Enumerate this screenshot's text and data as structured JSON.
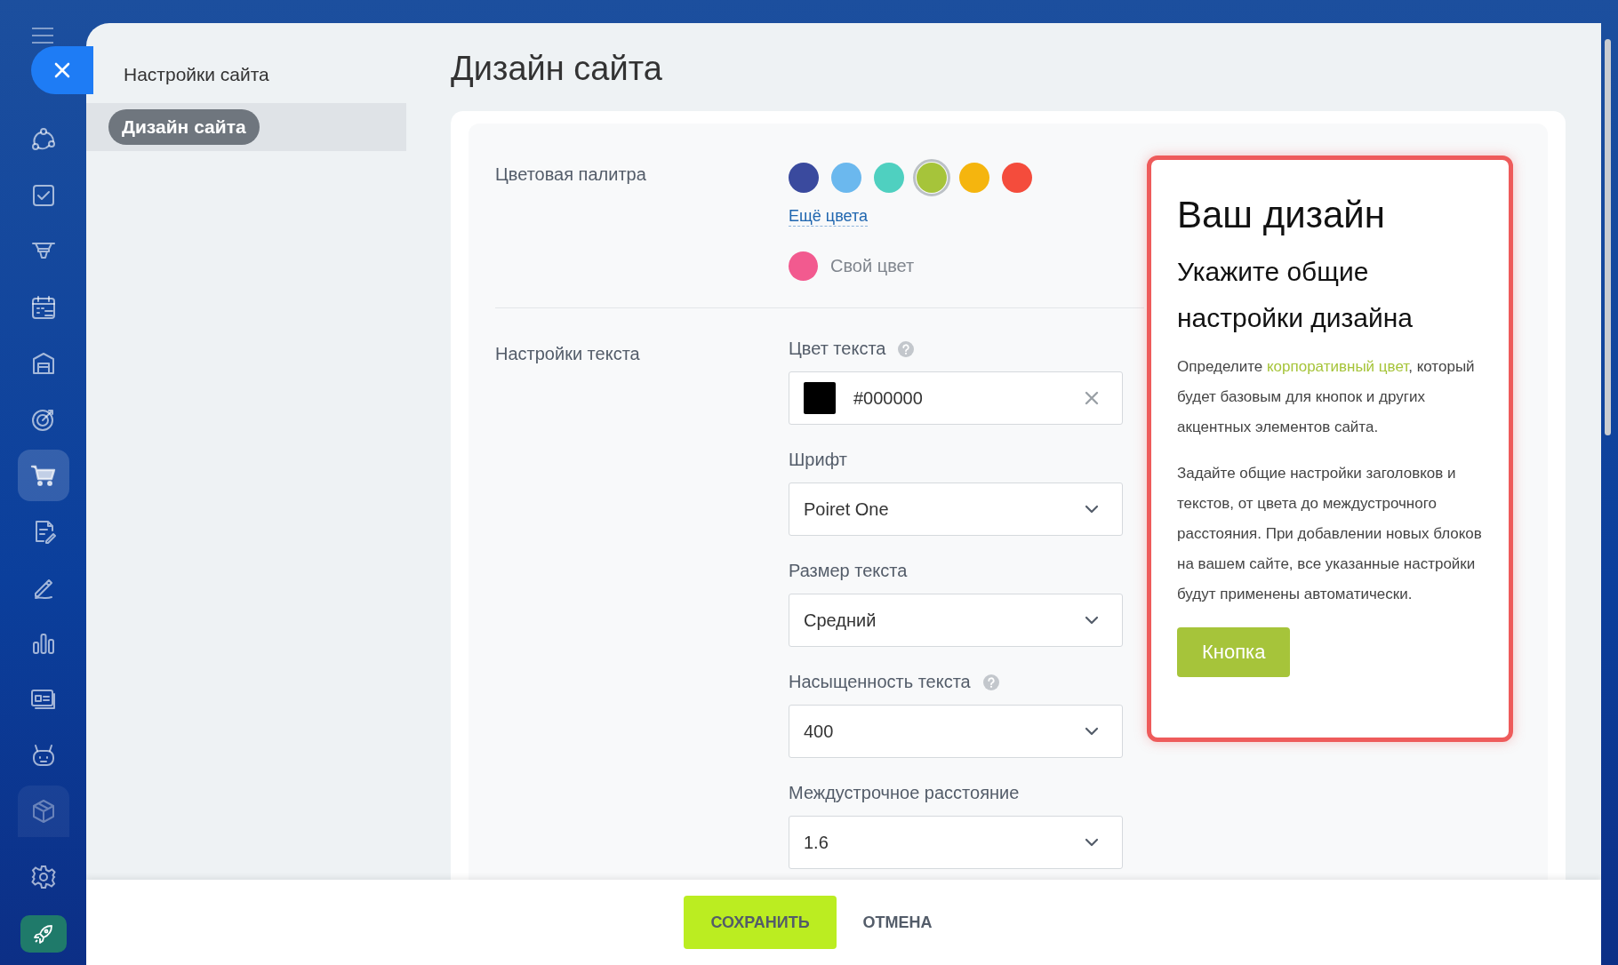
{
  "nav_rail": {
    "items": [
      {
        "kind": "nodes",
        "selected": false,
        "dimmed": false
      },
      {
        "kind": "checkbox",
        "selected": false,
        "dimmed": false
      },
      {
        "kind": "funnel",
        "selected": false,
        "dimmed": false
      },
      {
        "kind": "calendar",
        "selected": false,
        "dimmed": false
      },
      {
        "kind": "store",
        "selected": false,
        "dimmed": false
      },
      {
        "kind": "target",
        "selected": false,
        "dimmed": false
      },
      {
        "kind": "cart",
        "selected": true,
        "dimmed": false
      },
      {
        "kind": "document",
        "selected": false,
        "dimmed": false
      },
      {
        "kind": "pen",
        "selected": false,
        "dimmed": false
      },
      {
        "kind": "chart",
        "selected": false,
        "dimmed": false
      },
      {
        "kind": "card",
        "selected": false,
        "dimmed": false
      },
      {
        "kind": "robot",
        "selected": false,
        "dimmed": false
      },
      {
        "kind": "box",
        "selected": false,
        "dimmed": true
      }
    ]
  },
  "settings_menu": {
    "title": "Настройки сайта",
    "items": [
      {
        "label": "Дизайн сайта",
        "selected": true
      }
    ]
  },
  "page_title": "Дизайн сайта",
  "palette": {
    "label": "Цветовая палитра",
    "swatches": [
      {
        "color": "#3a4a9e",
        "selected": false
      },
      {
        "color": "#6bb8ee",
        "selected": false
      },
      {
        "color": "#4fd0c0",
        "selected": false
      },
      {
        "color": "#a6c43a",
        "selected": true
      },
      {
        "color": "#f5b50e",
        "selected": false
      },
      {
        "color": "#f44c3c",
        "selected": false
      }
    ],
    "more_link": "Ещё цвета",
    "custom": {
      "color": "#f25a8f",
      "label": "Свой цвет"
    }
  },
  "text_settings": {
    "label": "Настройки текста",
    "fields": [
      {
        "kind": "color",
        "label": "Цвет текста",
        "help": true,
        "value": "#000000",
        "color": "#000000"
      },
      {
        "kind": "select",
        "label": "Шрифт",
        "help": false,
        "value": "Poiret One"
      },
      {
        "kind": "select",
        "label": "Размер текста",
        "help": false,
        "value": "Средний"
      },
      {
        "kind": "select",
        "label": "Насыщенность текста",
        "help": true,
        "value": "400"
      },
      {
        "kind": "select",
        "label": "Междустрочное расстояние",
        "help": false,
        "value": "1.6"
      }
    ]
  },
  "preview": {
    "title": "Ваш дизайн",
    "subtitle": "Укажите общие настройки дизайна",
    "paragraphs": [
      {
        "before": "Определите ",
        "link": "корпоративный цвет",
        "after": ", который будет базовым для кнопок и других акцентных элементов сайта."
      },
      {
        "before": "Задайте общие настройки заголовков и текстов, от цвета до междустрочного расстояния. При добавлении новых блоков на вашем сайте, все указанные настройки будут применены автоматически."
      }
    ],
    "button": "Кнопка"
  },
  "footer": {
    "save": "СОХРАНИТЬ",
    "cancel": "ОТМЕНА"
  }
}
